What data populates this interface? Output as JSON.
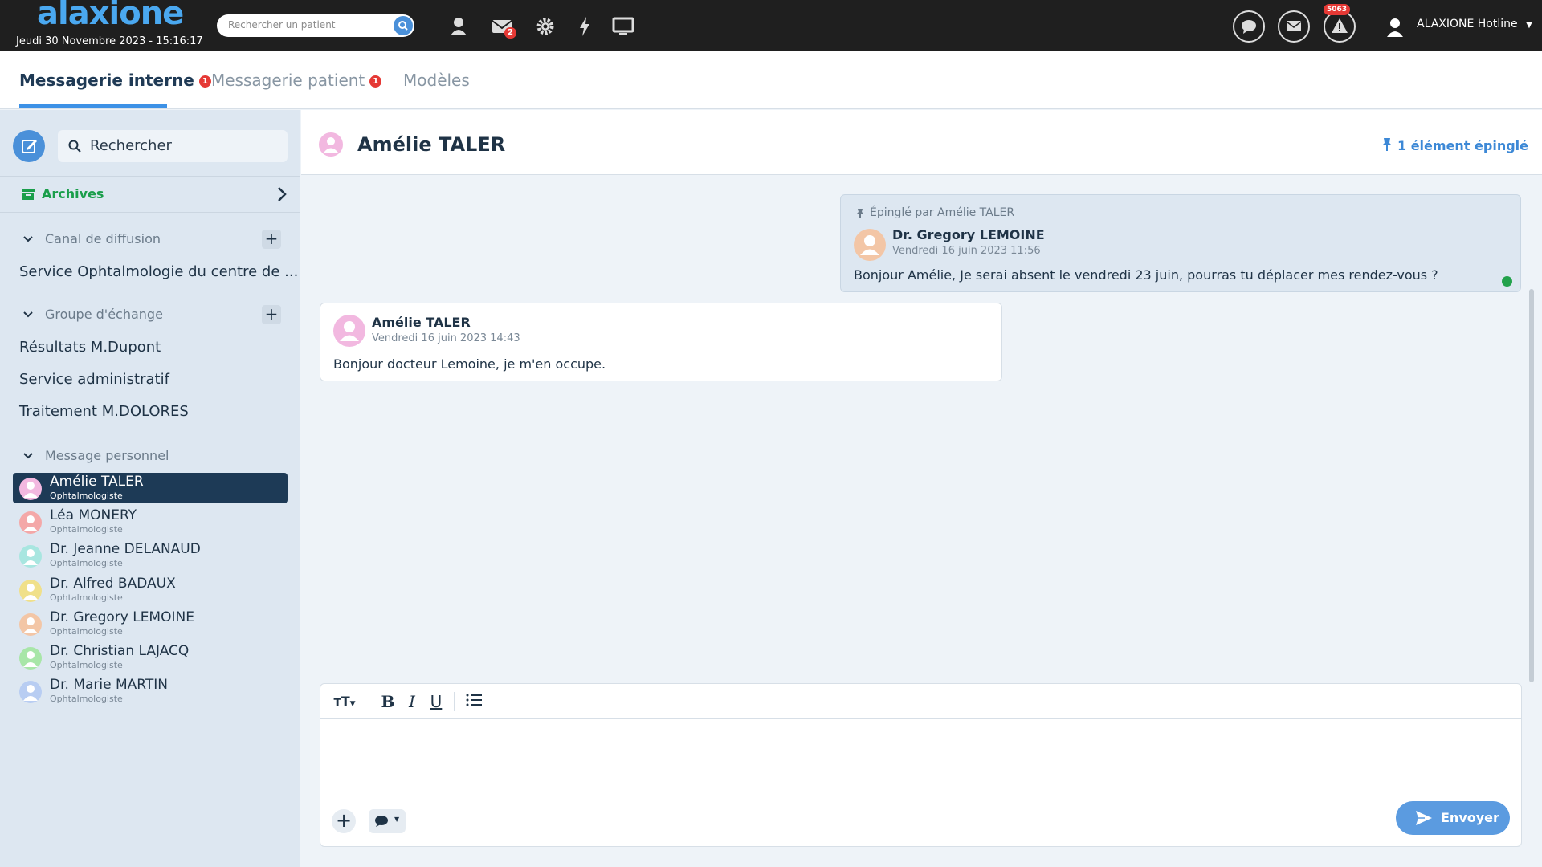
{
  "header": {
    "logo_text": "alaxione",
    "datetime": "Jeudi 30 Novembre 2023 - 15:16:17",
    "patient_search_placeholder": "Rechercher un patient",
    "messages_badge": "2",
    "alerts_badge": "5063",
    "user_name": "ALAXIONE Hotline"
  },
  "tabs": [
    {
      "label": "Messagerie interne",
      "badge": "1"
    },
    {
      "label": "Messagerie patient",
      "badge": "1"
    },
    {
      "label": "Modèles"
    }
  ],
  "sidebar": {
    "search_placeholder": "Rechercher",
    "archives_label": "Archives",
    "sections": {
      "broadcast": {
        "title": "Canal de diffusion",
        "items": [
          "Service Ophtalmologie du centre de ..."
        ]
      },
      "groups": {
        "title": "Groupe d'échange",
        "items": [
          "Résultats M.Dupont",
          "Service administratif",
          "Traitement M.DOLORES"
        ]
      },
      "personal": {
        "title": "Message personnel"
      }
    },
    "contacts": [
      {
        "name": "Amélie TALER",
        "role": "Ophtalmologiste",
        "color": "#f2b8e0"
      },
      {
        "name": "Léa MONERY",
        "role": "Ophtalmologiste",
        "color": "#f4a8a8"
      },
      {
        "name": "Dr. Jeanne DELANAUD",
        "role": "Ophtalmologiste",
        "color": "#a8e6e0"
      },
      {
        "name": "Dr. Alfred BADAUX",
        "role": "Ophtalmologiste",
        "color": "#f0e08a"
      },
      {
        "name": "Dr. Gregory LEMOINE",
        "role": "Ophtalmologiste",
        "color": "#f3c6a6"
      },
      {
        "name": "Dr. Christian LAJACQ",
        "role": "Ophtalmologiste",
        "color": "#a8e6a8"
      },
      {
        "name": "Dr. Marie MARTIN",
        "role": "Ophtalmologiste",
        "color": "#b8cdf2"
      }
    ]
  },
  "conversation": {
    "title": "Amélie TALER",
    "pinned_label": "1 élément épinglé",
    "messages": [
      {
        "pinned_by": "Épinglé par Amélie TALER",
        "author": "Dr. Gregory LEMOINE",
        "date": "Vendredi 16 juin 2023 11:56",
        "text": "Bonjour Amélie, Je serai absent le vendredi 23 juin, pourras tu déplacer mes rendez-vous ?"
      },
      {
        "author": "Amélie TALER",
        "date": "Vendredi 16 juin 2023 14:43",
        "text": "Bonjour docteur Lemoine, je m'en occupe."
      }
    ]
  },
  "editor": {
    "value": "",
    "send_label": "Envoyer"
  },
  "colors": {
    "accent": "#3c91e6",
    "topbar": "#1f1f1f",
    "selected": "#1d3a56",
    "archives": "#1a9e4b",
    "badge": "#e53935"
  }
}
